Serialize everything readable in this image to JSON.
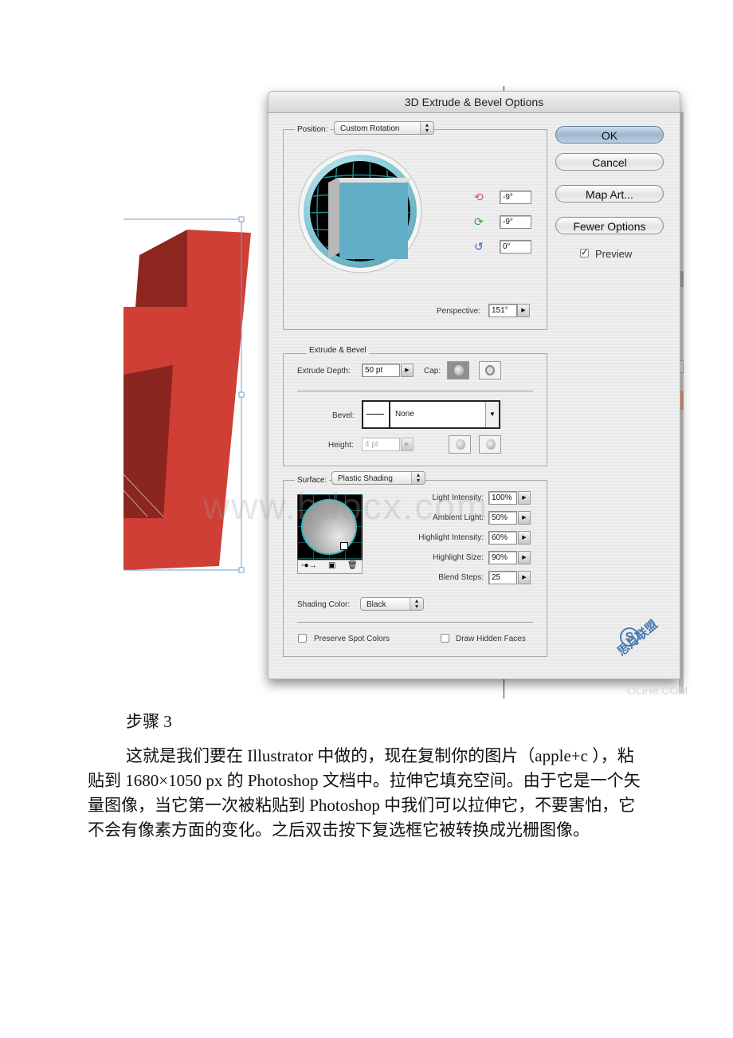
{
  "dialog": {
    "title": "3D Extrude & Bevel Options",
    "position": {
      "label": "Position:",
      "preset": "Custom Rotation",
      "rotation_x": "-9°",
      "rotation_y": "-9°",
      "rotation_z": "0°",
      "perspective_label": "Perspective:",
      "perspective_value": "151°"
    },
    "buttons": {
      "ok": "OK",
      "cancel": "Cancel",
      "map_art": "Map Art...",
      "fewer_options": "Fewer Options"
    },
    "preview": {
      "label": "Preview",
      "checked": true
    },
    "extrude_bevel": {
      "group_label": "Extrude & Bevel",
      "depth_label": "Extrude Depth:",
      "depth_value": "50 pt",
      "cap_label": "Cap:",
      "bevel_label": "Bevel:",
      "bevel_value": "None",
      "height_label": "Height:",
      "height_value": "4 pt"
    },
    "surface": {
      "label": "Surface:",
      "value": "Plastic Shading",
      "params": [
        {
          "label": "Light Intensity:",
          "value": "100%"
        },
        {
          "label": "Ambient Light:",
          "value": "50%"
        },
        {
          "label": "Highlight Intensity:",
          "value": "60%"
        },
        {
          "label": "Highlight Size:",
          "value": "90%"
        },
        {
          "label": "Blend Steps:",
          "value": "25"
        }
      ],
      "shading_color_label": "Shading Color:",
      "shading_color_value": "Black",
      "preserve_spot_colors": {
        "label": "Preserve Spot Colors",
        "checked": false
      },
      "draw_hidden_faces": {
        "label": "Draw Hidden Faces",
        "checked": false
      }
    }
  },
  "watermarks": {
    "center": "www.bdocx.com",
    "corner": "OLiHe.COM",
    "logo_text": "思月联盟"
  },
  "document": {
    "heading": "步骤 3",
    "paragraph": "这就是我们要在 Illustrator 中做的，现在复制你的图片（apple+c ），粘贴到 1680×1050 px 的 Photoshop 文档中。拉伸它填充空间。由于它是一个矢量图像，当它第一次被粘贴到 Photoshop 中我们可以拉伸它，不要害怕，它不会有像素方面的变化。之后双击按下复选框它被转换成光栅图像。"
  },
  "colors": {
    "artwork_front": "#cf3f36",
    "artwork_side": "#8e2620",
    "selection": "#6ea0cc",
    "cube_face": "#62aec7",
    "track_ring": "#7fcbd8"
  }
}
